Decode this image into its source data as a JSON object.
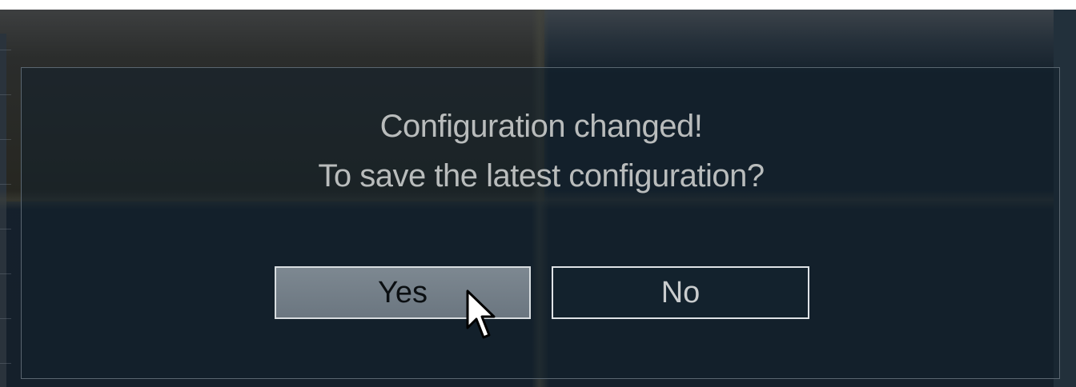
{
  "dialog": {
    "message_line1": "Configuration changed!",
    "message_line2": "To save the latest configuration?",
    "yes_label": "Yes",
    "no_label": "No"
  },
  "colors": {
    "dialog_background": "#15202b",
    "message_text": "#b9bcbc",
    "yes_button_fill": "#75808a",
    "no_button_fill": "#13222d",
    "button_border": "#dfe3e6"
  },
  "icons": {
    "pointer": "mouse-cursor-icon"
  }
}
